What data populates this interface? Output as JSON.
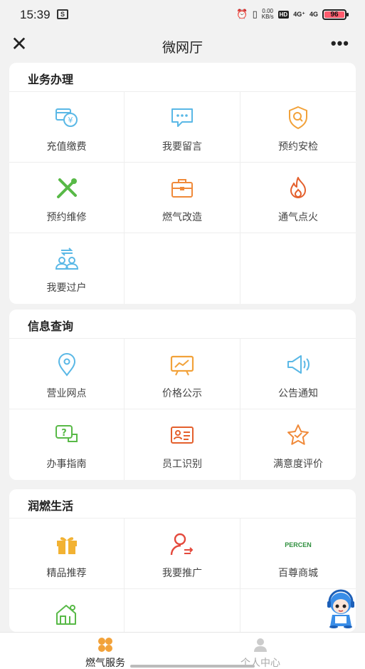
{
  "status_bar": {
    "time": "15:39",
    "notification_glyph": "S",
    "speed_value": "0.00",
    "speed_unit": "KB/s",
    "hd_label": "HD",
    "signal1": "4G⁺",
    "signal2": "4G",
    "battery": "96"
  },
  "nav": {
    "close_glyph": "✕",
    "title": "微网厅",
    "more_glyph": "•••"
  },
  "sections": [
    {
      "title": "业务办理",
      "items": [
        {
          "label": "充值缴费",
          "icon": "recharge-icon"
        },
        {
          "label": "我要留言",
          "icon": "message-icon"
        },
        {
          "label": "预约安检",
          "icon": "safety-check-icon"
        },
        {
          "label": "预约维修",
          "icon": "repair-icon"
        },
        {
          "label": "燃气改造",
          "icon": "toolbox-icon"
        },
        {
          "label": "通气点火",
          "icon": "flame-icon"
        },
        {
          "label": "我要过户",
          "icon": "transfer-icon"
        }
      ]
    },
    {
      "title": "信息查询",
      "items": [
        {
          "label": "营业网点",
          "icon": "location-icon"
        },
        {
          "label": "价格公示",
          "icon": "price-board-icon"
        },
        {
          "label": "公告通知",
          "icon": "speaker-icon"
        },
        {
          "label": "办事指南",
          "icon": "guide-icon"
        },
        {
          "label": "员工识别",
          "icon": "id-card-icon"
        },
        {
          "label": "满意度评价",
          "icon": "star-icon"
        }
      ]
    },
    {
      "title": "润燃生活",
      "items": [
        {
          "label": "精品推荐",
          "icon": "gift-icon"
        },
        {
          "label": "我要推广",
          "icon": "promote-icon"
        },
        {
          "label": "百尊商城",
          "icon": "percen-logo",
          "logo_text": "PERCEN"
        },
        {
          "label": "",
          "icon": "house-icon"
        }
      ]
    }
  ],
  "tabs": [
    {
      "label": "燃气服务",
      "icon": "gas-service-icon",
      "active": true
    },
    {
      "label": "个人中心",
      "icon": "person-icon",
      "active": false
    }
  ],
  "colors": {
    "blue": "#5ab8e6",
    "orange": "#f2a23a",
    "green": "#58b947",
    "red": "#e4493c",
    "brand_green": "#2f8f3e"
  }
}
